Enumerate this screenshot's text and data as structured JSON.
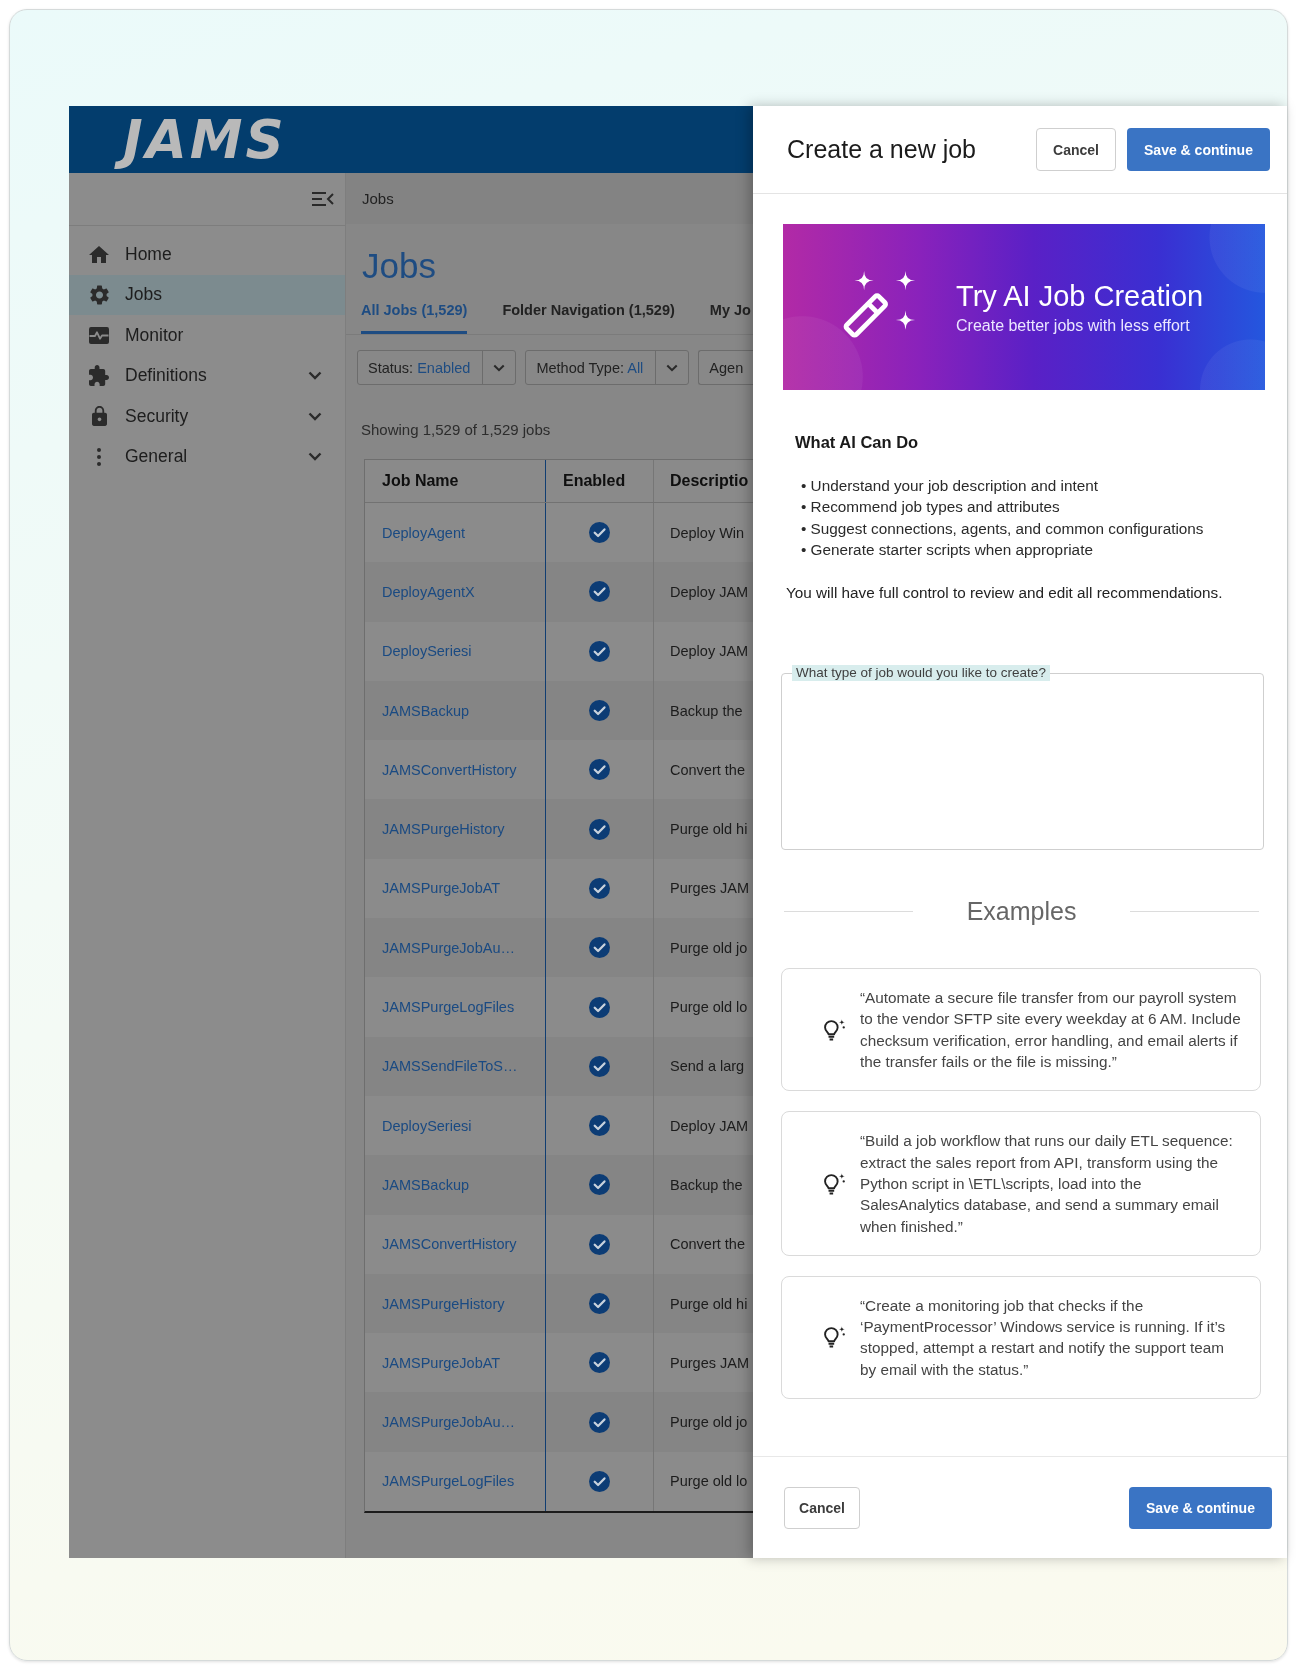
{
  "app": {
    "logo": "JAMS"
  },
  "sidebar": {
    "items": [
      {
        "label": "Home",
        "kind": "link",
        "selected": false
      },
      {
        "label": "Jobs",
        "kind": "link",
        "selected": true
      },
      {
        "label": "Monitor",
        "kind": "link",
        "selected": false
      },
      {
        "label": "Definitions",
        "kind": "group",
        "selected": false
      },
      {
        "label": "Security",
        "kind": "group",
        "selected": false
      },
      {
        "label": "General",
        "kind": "group",
        "selected": false
      }
    ]
  },
  "breadcrumb": "Jobs",
  "page": {
    "title": "Jobs",
    "tabs": [
      {
        "label": "All Jobs (1,529)",
        "selected": true
      },
      {
        "label": "Folder Navigation (1,529)",
        "selected": false
      },
      {
        "label": "My Jo",
        "selected": false
      }
    ],
    "filters": [
      {
        "label": "Status:",
        "value": "Enabled"
      },
      {
        "label": "Method Type:",
        "value": "All"
      },
      {
        "label": "Agen"
      }
    ],
    "summary": "Showing 1,529 of 1,529 jobs"
  },
  "table": {
    "columns": [
      "Job Name",
      "Enabled",
      "Descriptio"
    ],
    "rows": [
      {
        "name": "DeployAgent",
        "enabled": true,
        "description": "Deploy Win"
      },
      {
        "name": "DeployAgentX",
        "enabled": true,
        "description": "Deploy JAM"
      },
      {
        "name": "DeploySeriesi",
        "enabled": true,
        "description": "Deploy JAM"
      },
      {
        "name": "JAMSBackup",
        "enabled": true,
        "description": "Backup the"
      },
      {
        "name": "JAMSConvertHistory",
        "enabled": true,
        "description": "Convert the"
      },
      {
        "name": "JAMSPurgeHistory",
        "enabled": true,
        "description": "Purge old hi"
      },
      {
        "name": "JAMSPurgeJobAT",
        "enabled": true,
        "description": "Purges JAM"
      },
      {
        "name": "JAMSPurgeJobAu…",
        "enabled": true,
        "description": "Purge old jo"
      },
      {
        "name": "JAMSPurgeLogFiles",
        "enabled": true,
        "description": "Purge old lo"
      },
      {
        "name": "JAMSSendFileToS…",
        "enabled": true,
        "description": "Send a larg"
      },
      {
        "name": "DeploySeriesi",
        "enabled": true,
        "description": "Deploy JAM"
      },
      {
        "name": "JAMSBackup",
        "enabled": true,
        "description": "Backup the"
      },
      {
        "name": "JAMSConvertHistory",
        "enabled": true,
        "description": "Convert the"
      },
      {
        "name": "JAMSPurgeHistory",
        "enabled": true,
        "description": "Purge old hi"
      },
      {
        "name": "JAMSPurgeJobAT",
        "enabled": true,
        "description": "Purges JAM"
      },
      {
        "name": "JAMSPurgeJobAu…",
        "enabled": true,
        "description": "Purge old jo"
      },
      {
        "name": "JAMSPurgeLogFiles",
        "enabled": true,
        "description": "Purge old lo"
      }
    ]
  },
  "panel": {
    "title": "Create a new job",
    "header_actions": [
      {
        "label": "Cancel",
        "kind": "secondary"
      },
      {
        "label": "Save & continue",
        "kind": "primary"
      }
    ],
    "banner": {
      "title": "Try AI Job Creation",
      "subtitle": "Create better jobs with less effort"
    },
    "capabilities": {
      "heading": "What AI Can Do",
      "items": [
        "• Understand your job description and intent",
        "• Recommend job types and attributes",
        "• Suggest connections, agents, and common configurations",
        "• Generate starter scripts when appropriate"
      ],
      "note": "You will have full control to review and edit all recommendations."
    },
    "prompt_field": {
      "label": "What type of job would you like to create?"
    },
    "examples": {
      "heading": "Examples",
      "items": [
        "“Automate a secure file transfer from our payroll system to the vendor SFTP site every weekday at 6 AM. Include checksum verification, error handling, and email alerts if the transfer fails or the file is missing.”",
        "“Build a job workflow that runs our daily ETL sequence: extract the sales report from API, transform using the Python script in \\ETL\\scripts, load into the SalesAnalytics database, and send a summary email when finished.”",
        "“Create a monitoring job that checks if the ‘PaymentProcessor’ Windows service is running. If it’s stopped, attempt a restart and notify the support team by email with the status.”"
      ]
    },
    "footer_actions": [
      {
        "label": "Cancel",
        "kind": "secondary"
      },
      {
        "label": "Save & continue",
        "kind": "primary"
      }
    ]
  }
}
